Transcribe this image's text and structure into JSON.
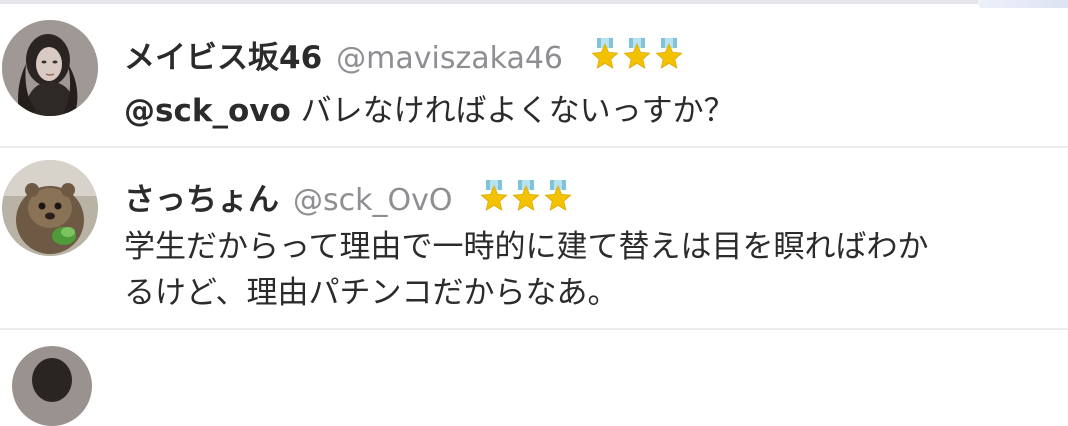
{
  "replies": [
    {
      "display_name": "メイビス坂46",
      "handle": "@maviszaka46",
      "badge_icons": [
        "star-ribbon-icon",
        "star-ribbon-icon",
        "star-ribbon-icon"
      ],
      "mention": "@sck_ovo",
      "text": " バレなければよくないっすか？"
    },
    {
      "display_name": "さっちょん",
      "handle": "@sck_OvO",
      "badge_icons": [
        "star-ribbon-icon",
        "star-ribbon-icon",
        "star-ribbon-icon"
      ],
      "text_lines": [
        "学生だからって理由で一時的に建て替えは目を瞑ればわか",
        "るけど、理由パチンコだからなあ。"
      ]
    }
  ],
  "colors": {
    "name": "#2b2b2b",
    "handle": "#8e8e93",
    "star": "#f2c200",
    "ribbon": "#7fc4d8",
    "divider": "#ececee"
  }
}
